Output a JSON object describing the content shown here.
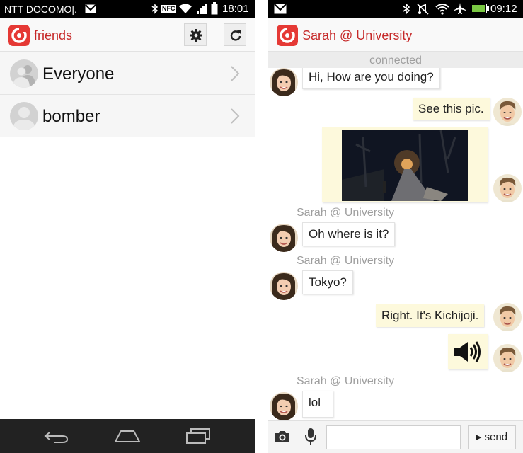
{
  "left": {
    "status": {
      "carrier": "NTT DOCOMO|.",
      "nfc": "NFC",
      "time": "18:01"
    },
    "appbar": {
      "title": "friends",
      "settings_icon": "gear-icon",
      "refresh_icon": "refresh-icon"
    },
    "friends": [
      {
        "label": "Everyone",
        "icon": "group-avatar-icon"
      },
      {
        "label": "bomber",
        "icon": "person-avatar-icon"
      }
    ],
    "navbar": {
      "icons": [
        "back-icon",
        "home-icon",
        "recent-apps-icon"
      ]
    }
  },
  "right": {
    "status": {
      "time": "09:12"
    },
    "appbar": {
      "title": "Sarah @ University"
    },
    "connection_status": "connected",
    "messages": [
      {
        "from": "them",
        "text": "Hi, How are you doing?"
      },
      {
        "from": "me",
        "text": "See this pic."
      },
      {
        "from": "me",
        "type": "image",
        "description": "night street photo"
      },
      {
        "sender": "Sarah @ University",
        "from": "them",
        "text": "Oh where is it?"
      },
      {
        "sender": "Sarah @ University",
        "from": "them",
        "text": "Tokyo?"
      },
      {
        "from": "me",
        "text": "Right. It's Kichijoji."
      },
      {
        "from": "me",
        "type": "audio",
        "icon": "speaker-icon"
      },
      {
        "sender": "Sarah @ University",
        "from": "them",
        "text": "lol"
      }
    ],
    "composer": {
      "camera_icon": "camera-icon",
      "mic_icon": "microphone-icon",
      "input_value": "",
      "send_label": "▸ send"
    }
  },
  "colors": {
    "accent": "#c62828",
    "logo": "#e53935",
    "outgoing_bubble": "#fdf9dc",
    "status_bar": "#000000",
    "nav_bar": "#222222",
    "battery": "#7ac943"
  }
}
